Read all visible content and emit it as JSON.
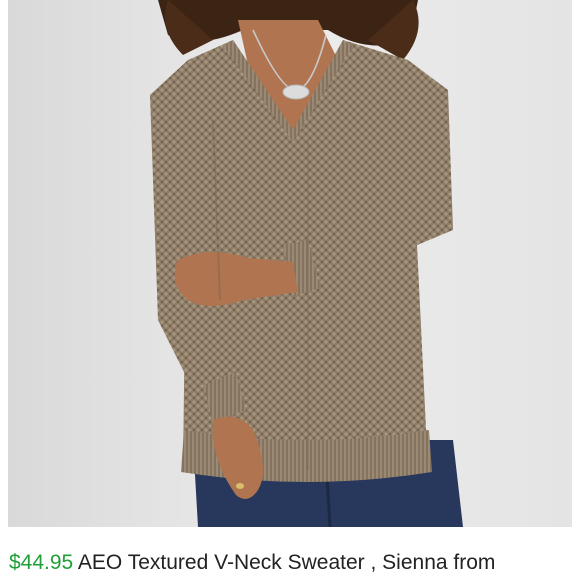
{
  "listing": {
    "price": "$44.95",
    "title": "AEO Textured V-Neck Sweater , Sienna from",
    "image_subject": "sweater-model-photo"
  },
  "colors": {
    "price": "#21a038",
    "title": "#222222",
    "backdrop": "#e7e7e7",
    "sweater": "#8c7a64",
    "jeans": "#27385c"
  }
}
